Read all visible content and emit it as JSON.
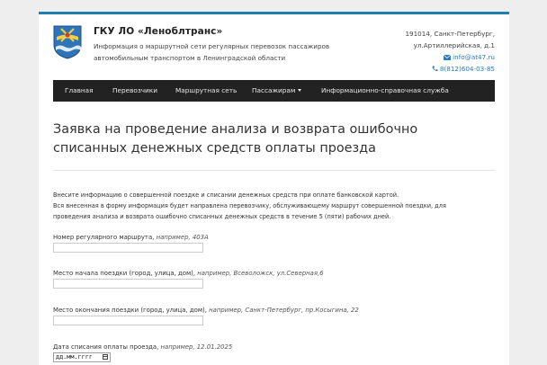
{
  "header": {
    "org_title": "ГКУ ЛО «Леноблтранс»",
    "org_description": "Информация о маршрутной сети регулярных перевозок пассажиров автомобильным транспортом в Ленинградской области",
    "address_line1": "191014, Санкт-Петербург,",
    "address_line2": "ул.Артиллерийская, д.1",
    "email": "info@at47.ru",
    "phone": "8(812)604-03-85",
    "logo_icon": "coat-of-arms-icon",
    "link_color": "#2a7bbf"
  },
  "nav": {
    "items": [
      {
        "label": "Главная"
      },
      {
        "label": "Перевозчики"
      },
      {
        "label": "Маршрутная сеть"
      },
      {
        "label": "Пассажирам"
      },
      {
        "label": "Информационно-справочная служба"
      }
    ],
    "background": "#222222"
  },
  "main": {
    "title": "Заявка на проведение анализа и возврата ошибочно списанных денежных средств оплаты проезда",
    "intro_line1": "Внесите информацию о совершенной поездке и списании денежных средств при оплате банковской картой.",
    "intro_line2": "Вся внесенная в форму информация будет направлена перевозчику, обслуживающему маршрут совершенной поездки, для проведения анализа и возврата ошибочно списанных денежных средств в течение 5 (пяти) рабочих дней.",
    "fields": [
      {
        "label": "Номер регулярного маршрута,",
        "hint": "например, 403А",
        "value": ""
      },
      {
        "label": "Место начала поездки (город, улица, дом),",
        "hint": "например, Всеволожск, ул.Северная,6",
        "value": ""
      },
      {
        "label": "Место окончания поездки (город, улица, дом),",
        "hint": "например, Санкт-Петербург, пр.Косыгина, 22",
        "value": ""
      },
      {
        "label": "Дата списания оплаты проезда,",
        "hint": "например, 12.01.2025",
        "value": "дд.мм.гггг"
      }
    ]
  }
}
